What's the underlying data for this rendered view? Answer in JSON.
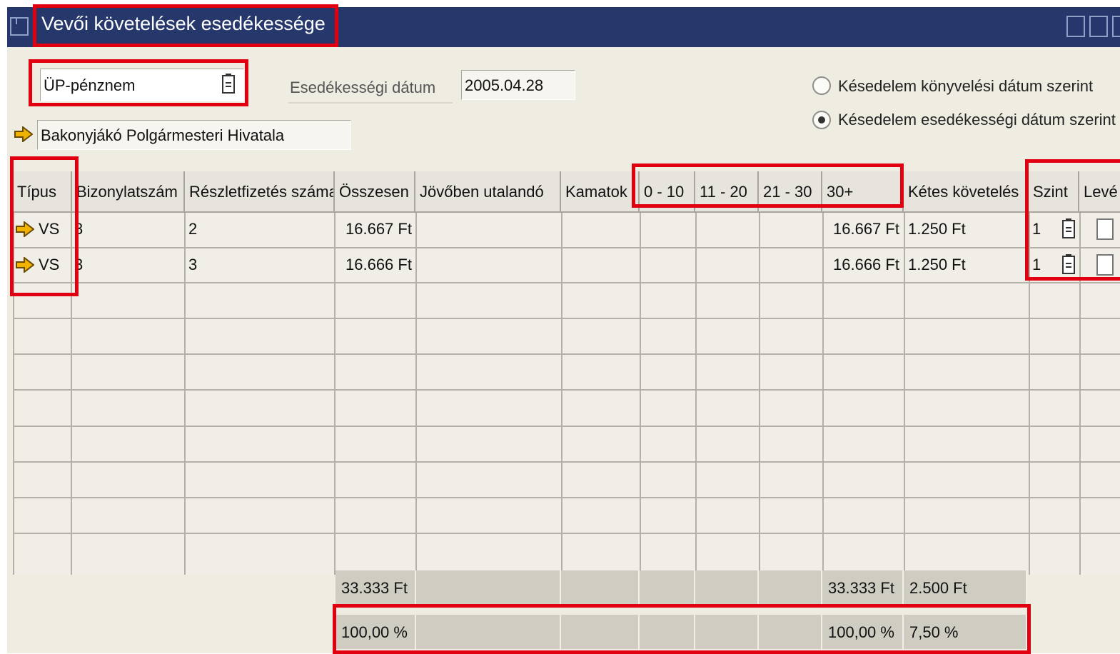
{
  "window": {
    "title": "Vevői követelések esedékessége"
  },
  "filters": {
    "currency_select": "ÜP-pénznem",
    "due_date_label": "Esedékességi dátum",
    "due_date_value": "2005.04.28",
    "radio_posting": "Késedelem könyvelési dátum szerint",
    "radio_due": "Késedelem esedékességi dátum szerint",
    "selected_radio": "radio_due",
    "customer_name": "Bakonyjákó Polgármesteri Hivatala"
  },
  "table": {
    "columns": [
      "Típus",
      "Bizonylatszám",
      "Részletfizetés száma",
      "Összesen",
      "Jövőben utalandó",
      "Kamatok",
      "0 - 10",
      "11 - 20",
      "21 - 30",
      "30+",
      "Kétes követelés",
      "Szint",
      "Levé"
    ],
    "rows": [
      {
        "type": "VS",
        "doc_no": "3",
        "installment": "2",
        "total": "16.667 Ft",
        "future": "",
        "interest": "",
        "b0_10": "",
        "b11_20": "",
        "b21_30": "",
        "b30p": "16.667 Ft",
        "doubtful": "1.250 Ft",
        "level": "1"
      },
      {
        "type": "VS",
        "doc_no": "3",
        "installment": "3",
        "total": "16.666 Ft",
        "future": "",
        "interest": "",
        "b0_10": "",
        "b11_20": "",
        "b21_30": "",
        "b30p": "16.666 Ft",
        "doubtful": "1.250 Ft",
        "level": "1"
      }
    ],
    "totals": {
      "total": "33.333 Ft",
      "b30p": "33.333 Ft",
      "doubtful": "2.500 Ft"
    },
    "percents": {
      "total": "100,00 %",
      "b30p": "100,00 %",
      "doubtful": "7,50 %"
    }
  },
  "colors": {
    "titlebar": "#26386b",
    "highlight": "#e00010",
    "arrow": "#f0b400"
  }
}
